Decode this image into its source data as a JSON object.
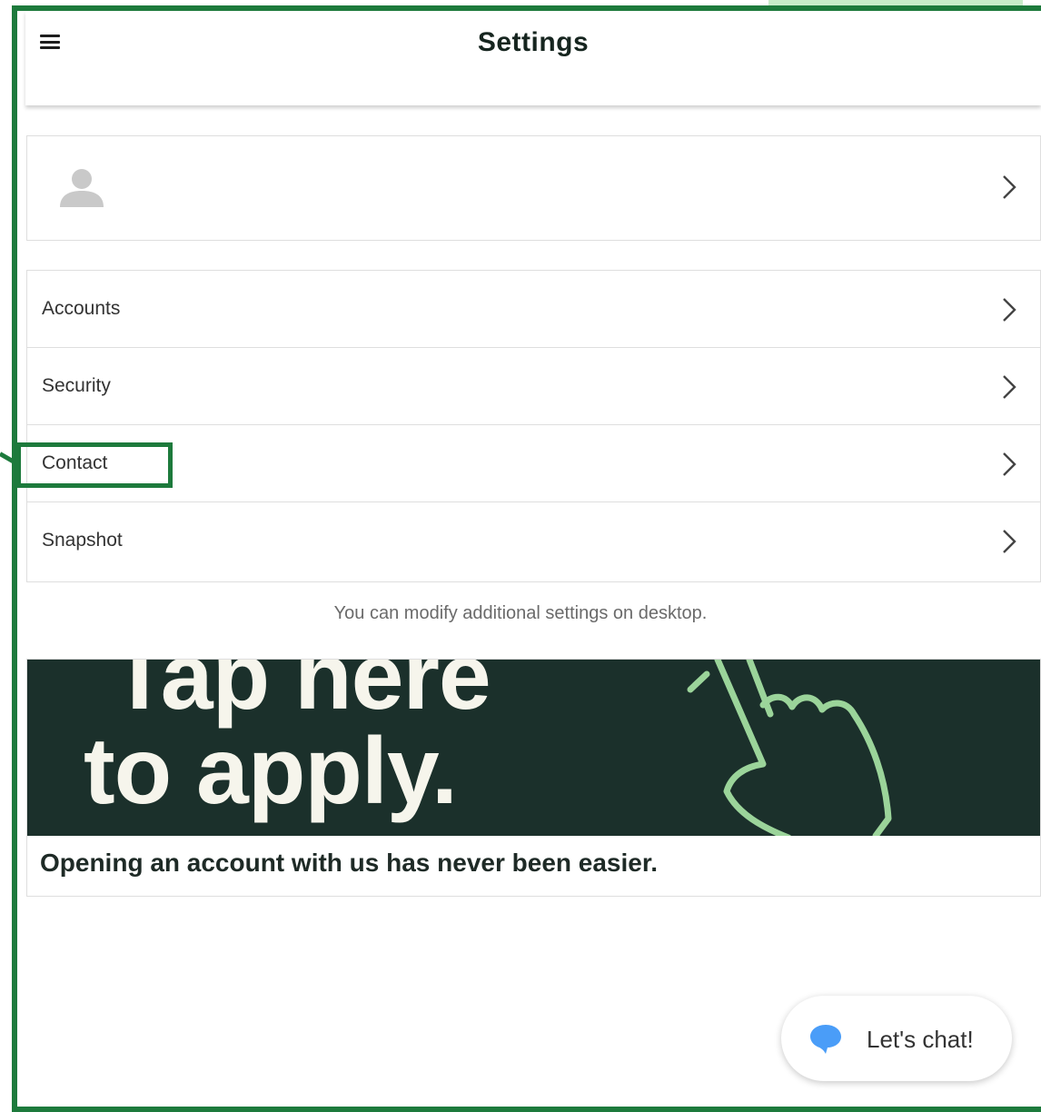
{
  "header": {
    "title": "Settings",
    "menu_icon": "hamburger-menu-icon"
  },
  "profile": {
    "avatar_icon": "user-avatar-icon",
    "chevron_icon": "chevron-right-icon"
  },
  "settings_items": [
    {
      "label": "Accounts"
    },
    {
      "label": "Security"
    },
    {
      "label": "Contact"
    },
    {
      "label": "Snapshot"
    }
  ],
  "note": "You can modify additional settings on desktop.",
  "promo": {
    "banner_line1": "Tap here",
    "banner_line2": "to apply.",
    "caption": "Opening an account with us has never been easier.",
    "banner_color": "#1b302b",
    "accent_color": "#9bd49a"
  },
  "chat": {
    "label": "Let's chat!",
    "icon": "chat-bubble-icon",
    "icon_color": "#4a9df8"
  },
  "annotation": {
    "highlight_color": "#1d7a3c"
  }
}
